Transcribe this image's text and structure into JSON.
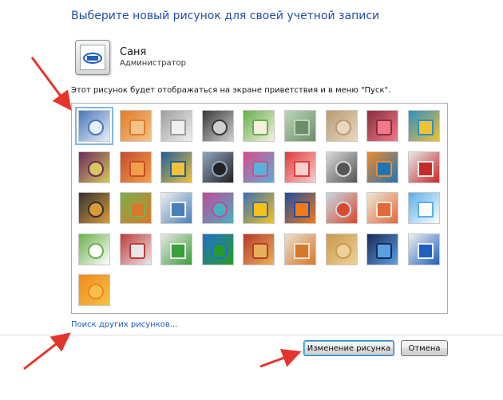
{
  "header": {
    "title": "Выберите новый рисунок для своей учетной записи"
  },
  "user": {
    "name": "Саня",
    "role": "Администратор"
  },
  "description": "Этот рисунок будет отображаться на экране приветствия и в меню \"Пуск\".",
  "pictures": [
    {
      "name": "ferris-wheel",
      "colors": [
        "#4a78b8",
        "#e8eef8"
      ],
      "selected": true
    },
    {
      "name": "starfish",
      "colors": [
        "#e07c2a",
        "#f4c38a"
      ]
    },
    {
      "name": "robot-toy",
      "colors": [
        "#9e9e9e",
        "#f0f0f0"
      ]
    },
    {
      "name": "turntable",
      "colors": [
        "#3a3a3a",
        "#cfcfcf"
      ]
    },
    {
      "name": "lucky-cat",
      "colors": [
        "#66b04c",
        "#f5f0e0"
      ]
    },
    {
      "name": "gyroscope",
      "colors": [
        "#bcd4b8",
        "#6b8f6a"
      ]
    },
    {
      "name": "kitten",
      "colors": [
        "#b99a72",
        "#e8d8c0"
      ]
    },
    {
      "name": "flower",
      "colors": [
        "#8a2e3e",
        "#f07a8a"
      ]
    },
    {
      "name": "windmill",
      "colors": [
        "#2c8fc9",
        "#f1c232"
      ]
    },
    {
      "name": "ball",
      "colors": [
        "#6b2a5e",
        "#d6c85a"
      ]
    },
    {
      "name": "fabric",
      "colors": [
        "#c64c2c",
        "#f1a04a"
      ]
    },
    {
      "name": "leaf",
      "colors": [
        "#1f5f98",
        "#f0c23a"
      ]
    },
    {
      "name": "dog",
      "colors": [
        "#8fa6c0",
        "#222222"
      ]
    },
    {
      "name": "crayons",
      "colors": [
        "#d94a8a",
        "#5ab0d8"
      ]
    },
    {
      "name": "umbrella",
      "colors": [
        "#e03a3a",
        "#f7d0d0"
      ]
    },
    {
      "name": "jacks",
      "colors": [
        "#d9d9d9",
        "#555555"
      ]
    },
    {
      "name": "stairs",
      "colors": [
        "#f08a2a",
        "#1c75b8"
      ]
    },
    {
      "name": "origami",
      "colors": [
        "#e8e8e8",
        "#c42a2a"
      ]
    },
    {
      "name": "guitar",
      "colors": [
        "#333333",
        "#d99a3a"
      ]
    },
    {
      "name": "pomeranian",
      "colors": [
        "#7cae4a",
        "#d9782a"
      ]
    },
    {
      "name": "toy-robot",
      "colors": [
        "#f0f0f0",
        "#4a80b8"
      ]
    },
    {
      "name": "scarves",
      "colors": [
        "#c04a9a",
        "#4ab0c0"
      ]
    },
    {
      "name": "sunflower",
      "colors": [
        "#3a70b8",
        "#f5c21a"
      ]
    },
    {
      "name": "fish",
      "colors": [
        "#1f4f9e",
        "#f07a1a"
      ]
    },
    {
      "name": "balloon",
      "colors": [
        "#c8d8e8",
        "#d94a2a"
      ]
    },
    {
      "name": "lamp",
      "colors": [
        "#f0e8d8",
        "#e06a3a"
      ]
    },
    {
      "name": "sailboat",
      "colors": [
        "#5aaee8",
        "#ffffff"
      ]
    },
    {
      "name": "soccer-ball",
      "colors": [
        "#6ab04a",
        "#ffffff"
      ]
    },
    {
      "name": "pencils",
      "colors": [
        "#c03a3a",
        "#e8e8e8"
      ]
    },
    {
      "name": "marbles",
      "colors": [
        "#e8e8e8",
        "#3aa03a"
      ]
    },
    {
      "name": "window",
      "colors": [
        "#1f70c9",
        "#2a9a2a"
      ]
    },
    {
      "name": "textile",
      "colors": [
        "#b83a2a",
        "#e8b05a"
      ]
    },
    {
      "name": "butterfly",
      "colors": [
        "#e8e0d0",
        "#d9782a"
      ]
    },
    {
      "name": "spiral",
      "colors": [
        "#c89a4a",
        "#f0d09a"
      ]
    },
    {
      "name": "lighthouse",
      "colors": [
        "#1a2a5a",
        "#5aa0e0"
      ]
    },
    {
      "name": "logo-tile",
      "colors": [
        "#f0f0f0",
        "#1f5fbf"
      ]
    },
    {
      "name": "gerbera",
      "colors": [
        "#f08a1a",
        "#f5c04a"
      ]
    }
  ],
  "links": {
    "search_more": "Поиск других рисунков..."
  },
  "buttons": {
    "change": "Изменение рисунка",
    "cancel": "Отмена"
  },
  "colors": {
    "heading": "#1e4fa6",
    "link": "#1e5fbf",
    "arrow": "#e5352b"
  }
}
